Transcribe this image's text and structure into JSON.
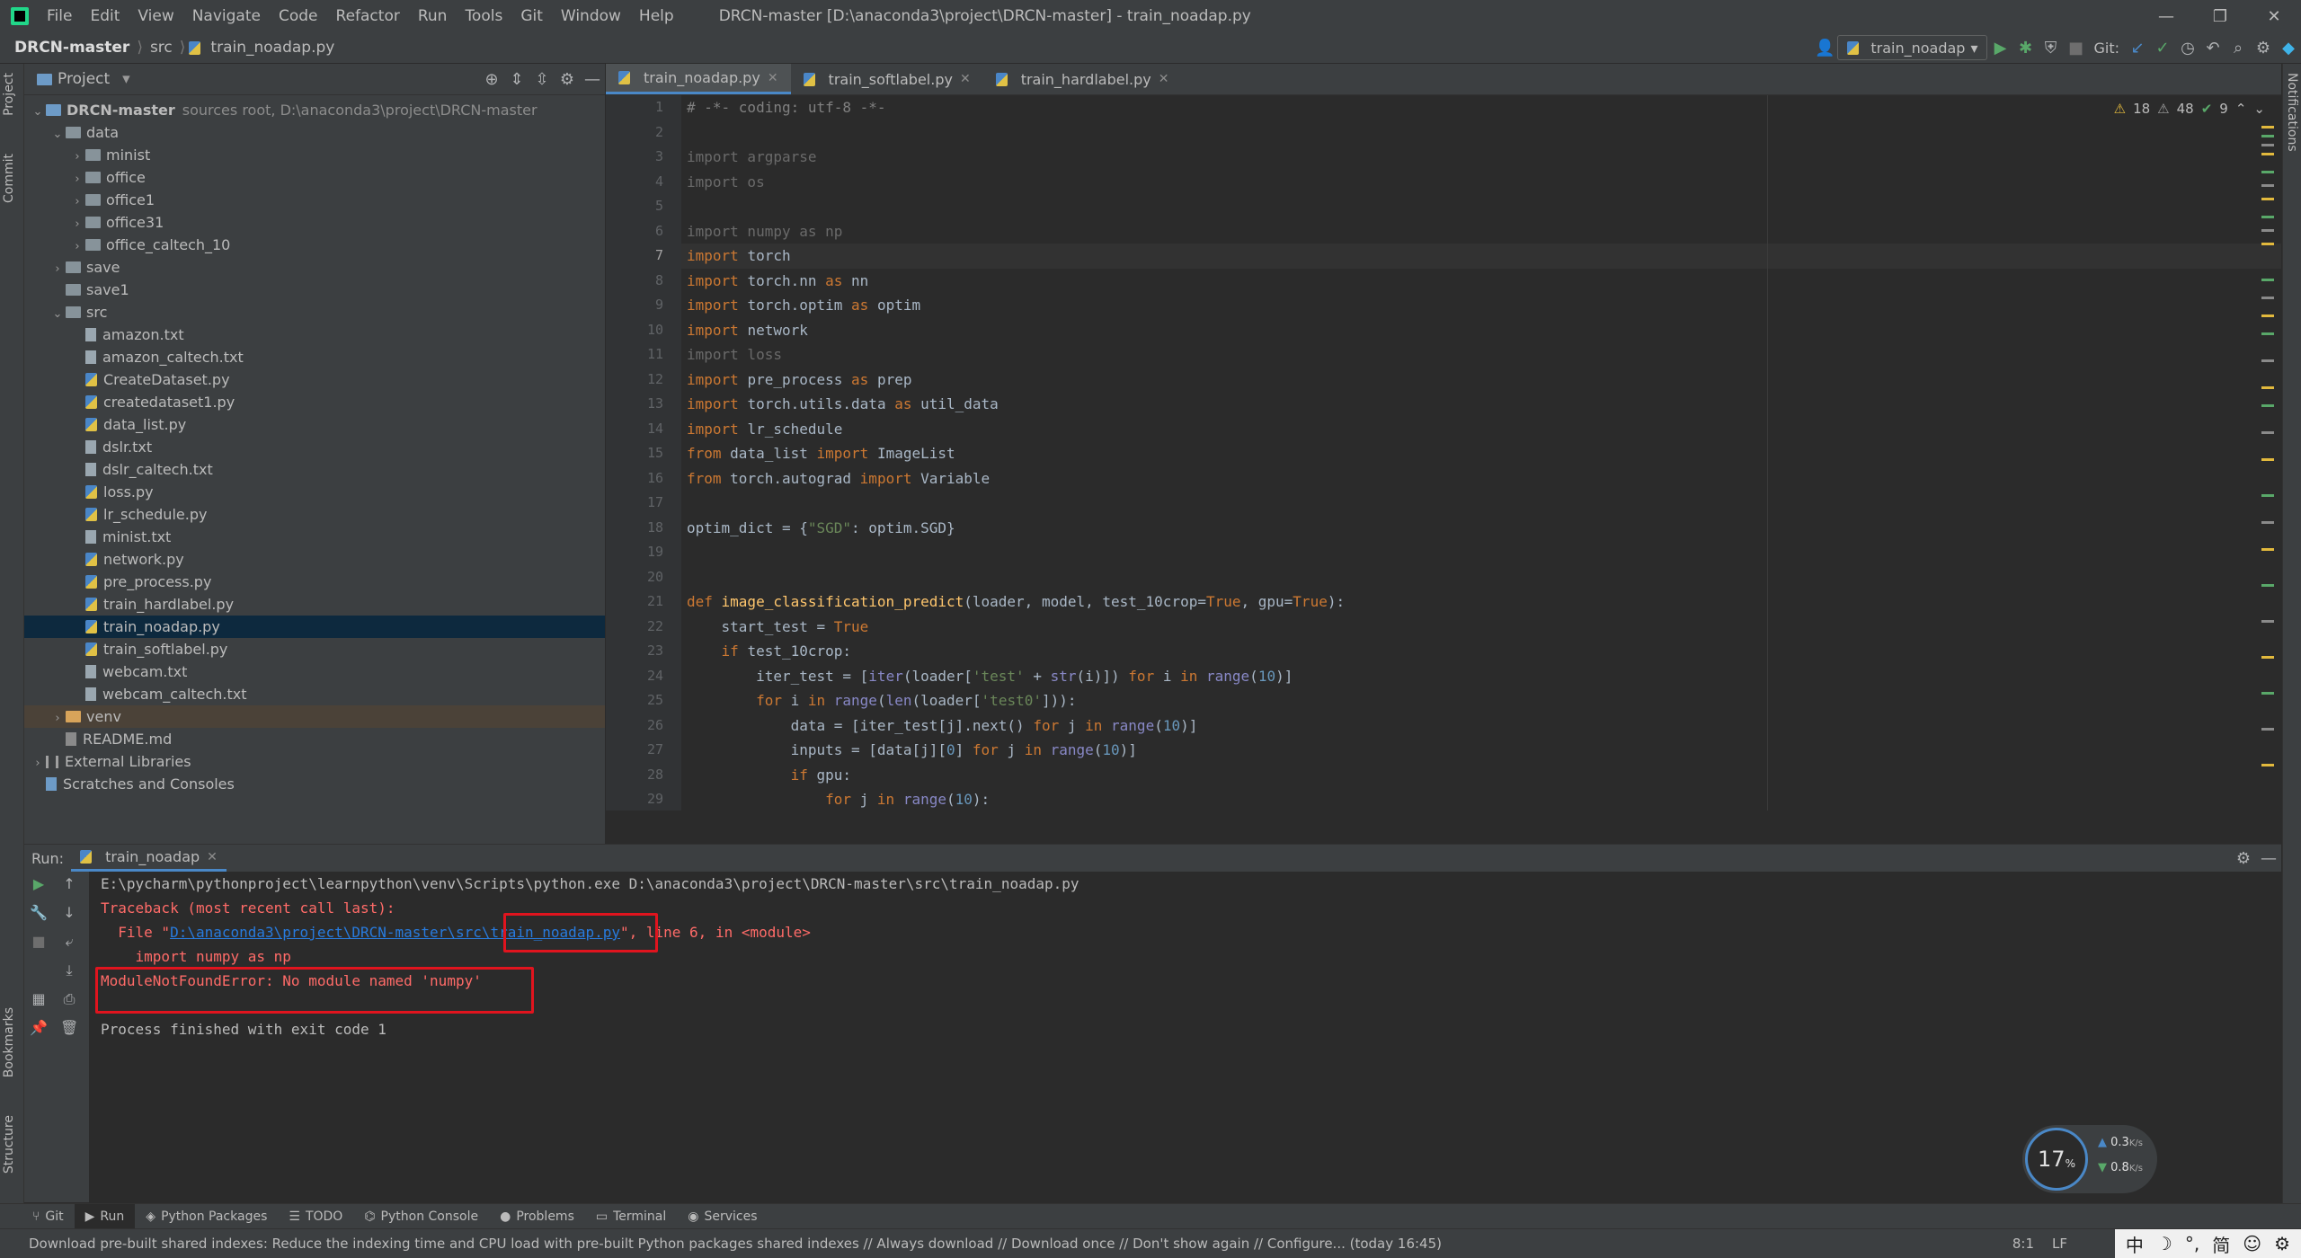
{
  "menu": [
    "File",
    "Edit",
    "View",
    "Navigate",
    "Code",
    "Refactor",
    "Run",
    "Tools",
    "Git",
    "Window",
    "Help"
  ],
  "window_title": "DRCN-master [D:\\anaconda3\\project\\DRCN-master] - train_noadap.py",
  "nav": {
    "project": "DRCN-master",
    "folder": "src",
    "file": "train_noadap.py"
  },
  "run_config": "train_noadap",
  "git_label": "Git:",
  "project_panel": {
    "title": "Project"
  },
  "tree": [
    {
      "label": "DRCN-master",
      "extra": "sources root,  D:\\anaconda3\\project\\DRCN-master",
      "depth": 0,
      "type": "folder-root",
      "open": true
    },
    {
      "label": "data",
      "depth": 1,
      "type": "folder",
      "open": true
    },
    {
      "label": "minist",
      "depth": 2,
      "type": "folder",
      "open": false
    },
    {
      "label": "office",
      "depth": 2,
      "type": "folder",
      "open": false
    },
    {
      "label": "office1",
      "depth": 2,
      "type": "folder",
      "open": false
    },
    {
      "label": "office31",
      "depth": 2,
      "type": "folder",
      "open": false
    },
    {
      "label": "office_caltech_10",
      "depth": 2,
      "type": "folder",
      "open": false
    },
    {
      "label": "save",
      "depth": 1,
      "type": "folder",
      "open": false
    },
    {
      "label": "save1",
      "depth": 1,
      "type": "folder",
      "open": null
    },
    {
      "label": "src",
      "depth": 1,
      "type": "folder",
      "open": true
    },
    {
      "label": "amazon.txt",
      "depth": 2,
      "type": "txt"
    },
    {
      "label": "amazon_caltech.txt",
      "depth": 2,
      "type": "txt"
    },
    {
      "label": "CreateDataset.py",
      "depth": 2,
      "type": "py"
    },
    {
      "label": "createdataset1.py",
      "depth": 2,
      "type": "py"
    },
    {
      "label": "data_list.py",
      "depth": 2,
      "type": "py"
    },
    {
      "label": "dslr.txt",
      "depth": 2,
      "type": "txt"
    },
    {
      "label": "dslr_caltech.txt",
      "depth": 2,
      "type": "txt"
    },
    {
      "label": "loss.py",
      "depth": 2,
      "type": "py"
    },
    {
      "label": "lr_schedule.py",
      "depth": 2,
      "type": "py"
    },
    {
      "label": "minist.txt",
      "depth": 2,
      "type": "txt"
    },
    {
      "label": "network.py",
      "depth": 2,
      "type": "py"
    },
    {
      "label": "pre_process.py",
      "depth": 2,
      "type": "py"
    },
    {
      "label": "train_hardlabel.py",
      "depth": 2,
      "type": "py"
    },
    {
      "label": "train_noadap.py",
      "depth": 2,
      "type": "py",
      "selected": true
    },
    {
      "label": "train_softlabel.py",
      "depth": 2,
      "type": "py"
    },
    {
      "label": "webcam.txt",
      "depth": 2,
      "type": "txt"
    },
    {
      "label": "webcam_caltech.txt",
      "depth": 2,
      "type": "txt"
    },
    {
      "label": "venv",
      "depth": 1,
      "type": "folder-orange",
      "open": false,
      "venv": true
    },
    {
      "label": "README.md",
      "depth": 1,
      "type": "md"
    },
    {
      "label": "External Libraries",
      "depth": 0,
      "type": "lib",
      "open": false
    },
    {
      "label": "Scratches and Consoles",
      "depth": 0,
      "type": "scratch"
    }
  ],
  "editor_tabs": [
    {
      "label": "train_noadap.py",
      "active": true
    },
    {
      "label": "train_softlabel.py",
      "active": false
    },
    {
      "label": "train_hardlabel.py",
      "active": false
    }
  ],
  "inspections": {
    "warnings": "18",
    "weak": "48",
    "ok": "9"
  },
  "code_lines": [
    [
      [
        "# -*- coding: utf-8 -*-",
        "#808080"
      ]
    ],
    [],
    [
      [
        "import argparse",
        "#6a6a6a"
      ]
    ],
    [
      [
        "import os",
        "#6a6a6a"
      ]
    ],
    [],
    [
      [
        "import numpy as np",
        "#6a6a6a"
      ]
    ],
    [
      [
        "import ",
        "#cc7832"
      ],
      [
        "torch",
        "#a9b7c6"
      ]
    ],
    [
      [
        "import ",
        "#cc7832"
      ],
      [
        "torch",
        "#a9b7c6"
      ],
      [
        ".nn ",
        "#a9b7c6"
      ],
      [
        "as ",
        "#cc7832"
      ],
      [
        "nn",
        "#a9b7c6"
      ]
    ],
    [
      [
        "import ",
        "#cc7832"
      ],
      [
        "torch",
        "#a9b7c6"
      ],
      [
        ".optim ",
        "#a9b7c6"
      ],
      [
        "as ",
        "#cc7832"
      ],
      [
        "optim",
        "#a9b7c6"
      ]
    ],
    [
      [
        "import ",
        "#cc7832"
      ],
      [
        "network",
        "#a9b7c6"
      ]
    ],
    [
      [
        "import loss",
        "#6a6a6a"
      ]
    ],
    [
      [
        "import ",
        "#cc7832"
      ],
      [
        "pre_process ",
        "#a9b7c6"
      ],
      [
        "as ",
        "#cc7832"
      ],
      [
        "prep",
        "#a9b7c6"
      ]
    ],
    [
      [
        "import ",
        "#cc7832"
      ],
      [
        "torch",
        "#a9b7c6"
      ],
      [
        ".utils.data ",
        "#a9b7c6"
      ],
      [
        "as ",
        "#cc7832"
      ],
      [
        "util_data",
        "#a9b7c6"
      ]
    ],
    [
      [
        "import ",
        "#cc7832"
      ],
      [
        "lr_schedule",
        "#a9b7c6"
      ]
    ],
    [
      [
        "from ",
        "#cc7832"
      ],
      [
        "data_list ",
        "#a9b7c6"
      ],
      [
        "import ",
        "#cc7832"
      ],
      [
        "ImageList",
        "#a9b7c6"
      ]
    ],
    [
      [
        "from ",
        "#cc7832"
      ],
      [
        "torch",
        "#a9b7c6"
      ],
      [
        ".autograd ",
        "#a9b7c6"
      ],
      [
        "import ",
        "#cc7832"
      ],
      [
        "Variable",
        "#a9b7c6"
      ]
    ],
    [],
    [
      [
        "optim_dict = {",
        "#a9b7c6"
      ],
      [
        "\"SGD\"",
        "#6a8759"
      ],
      [
        ": optim.SGD}",
        "#a9b7c6"
      ]
    ],
    [],
    [],
    [
      [
        "def ",
        "#cc7832"
      ],
      [
        "image_classification_predict",
        "#ffc66d"
      ],
      [
        "(loader, model, test_10crop=",
        "#a9b7c6"
      ],
      [
        "True",
        "#cc7832"
      ],
      [
        ", gpu=",
        "#a9b7c6"
      ],
      [
        "True",
        "#cc7832"
      ],
      [
        "):",
        "#a9b7c6"
      ]
    ],
    [
      [
        "    start_test = ",
        "#a9b7c6"
      ],
      [
        "True",
        "#cc7832"
      ]
    ],
    [
      [
        "    ",
        "#a9b7c6"
      ],
      [
        "if ",
        "#cc7832"
      ],
      [
        "test_10crop:",
        "#a9b7c6"
      ]
    ],
    [
      [
        "        iter_test = [",
        "#a9b7c6"
      ],
      [
        "iter",
        "#8888c6"
      ],
      [
        "(loader[",
        "#a9b7c6"
      ],
      [
        "'test'",
        "#6a8759"
      ],
      [
        " + ",
        "#a9b7c6"
      ],
      [
        "str",
        "#8888c6"
      ],
      [
        "(i)]) ",
        "#a9b7c6"
      ],
      [
        "for ",
        "#cc7832"
      ],
      [
        "i ",
        "#a9b7c6"
      ],
      [
        "in ",
        "#cc7832"
      ],
      [
        "range",
        "#8888c6"
      ],
      [
        "(",
        "#a9b7c6"
      ],
      [
        "10",
        "#6897bb"
      ],
      [
        ")]",
        "#a9b7c6"
      ]
    ],
    [
      [
        "        ",
        "#a9b7c6"
      ],
      [
        "for ",
        "#cc7832"
      ],
      [
        "i ",
        "#a9b7c6"
      ],
      [
        "in ",
        "#cc7832"
      ],
      [
        "range",
        "#8888c6"
      ],
      [
        "(",
        "#a9b7c6"
      ],
      [
        "len",
        "#8888c6"
      ],
      [
        "(loader[",
        "#a9b7c6"
      ],
      [
        "'test0'",
        "#6a8759"
      ],
      [
        "])):",
        "#a9b7c6"
      ]
    ],
    [
      [
        "            data = [",
        "#a9b7c6"
      ],
      [
        "iter_test[j].",
        "#a9b7c6"
      ],
      [
        "next",
        "#a9b7c6"
      ],
      [
        "() ",
        "#a9b7c6"
      ],
      [
        "for ",
        "#cc7832"
      ],
      [
        "j ",
        "#a9b7c6"
      ],
      [
        "in ",
        "#cc7832"
      ],
      [
        "range",
        "#8888c6"
      ],
      [
        "(",
        "#a9b7c6"
      ],
      [
        "10",
        "#6897bb"
      ],
      [
        ")]",
        "#a9b7c6"
      ]
    ],
    [
      [
        "            inputs = [data[j][",
        "#a9b7c6"
      ],
      [
        "0",
        "#6897bb"
      ],
      [
        "] ",
        "#a9b7c6"
      ],
      [
        "for ",
        "#cc7832"
      ],
      [
        "j ",
        "#a9b7c6"
      ],
      [
        "in ",
        "#cc7832"
      ],
      [
        "range",
        "#8888c6"
      ],
      [
        "(",
        "#a9b7c6"
      ],
      [
        "10",
        "#6897bb"
      ],
      [
        ")]",
        "#a9b7c6"
      ]
    ],
    [
      [
        "            ",
        "#a9b7c6"
      ],
      [
        "if ",
        "#cc7832"
      ],
      [
        "gpu:",
        "#a9b7c6"
      ]
    ],
    [
      [
        "                ",
        "#a9b7c6"
      ],
      [
        "for ",
        "#cc7832"
      ],
      [
        "j ",
        "#a9b7c6"
      ],
      [
        "in ",
        "#cc7832"
      ],
      [
        "range",
        "#8888c6"
      ],
      [
        "(",
        "#a9b7c6"
      ],
      [
        "10",
        "#6897bb"
      ],
      [
        "):",
        "#a9b7c6"
      ]
    ]
  ],
  "line_numbers": [
    "1",
    "2",
    "3",
    "4",
    "5",
    "6",
    "7",
    "8",
    "9",
    "10",
    "11",
    "12",
    "13",
    "14",
    "15",
    "16",
    "17",
    "18",
    "19",
    "20",
    "21",
    "22",
    "23",
    "24",
    "25",
    "26",
    "27",
    "28",
    "29"
  ],
  "run_panel": {
    "label": "Run:",
    "tab": "train_noadap"
  },
  "console": {
    "line1": "E:\\pycharm\\pythonproject\\learnpython\\venv\\Scripts\\python.exe D:\\anaconda3\\project\\DRCN-master\\src\\train_noadap.py",
    "line2": "Traceback (most recent call last):",
    "line3_pre": "  File \"",
    "line3_link1": "D:\\anaconda3\\project\\DRCN-master\\src\\",
    "line3_link2": "train_noadap.py",
    "line3_post": "\", line 6, in <module>",
    "line4": "    import numpy as np",
    "line5": "ModuleNotFoundError: No module named 'numpy'",
    "line6": "Process finished with exit code 1"
  },
  "network": {
    "cpu": "17",
    "cpu_unit": "%",
    "up": "0.3",
    "up_unit": "K/s",
    "down": "0.8",
    "down_unit": "K/s"
  },
  "bottom_tools": [
    {
      "label": "Git",
      "active": false
    },
    {
      "label": "Run",
      "active": true
    },
    {
      "label": "Python Packages",
      "active": false
    },
    {
      "label": "TODO",
      "active": false
    },
    {
      "label": "Python Console",
      "active": false
    },
    {
      "label": "Problems",
      "active": false
    },
    {
      "label": "Terminal",
      "active": false
    },
    {
      "label": "Services",
      "active": false
    }
  ],
  "status": {
    "message": "Download pre-built shared indexes: Reduce the indexing time and CPU load with pre-built Python packages shared indexes // Always download // Download once // Don't show again // Configure... (today 16:45)",
    "position": "8:1",
    "line_sep": "LF"
  },
  "ime": [
    "中",
    "☽",
    "°,",
    "简",
    "☺",
    "⚙"
  ],
  "side_tabs": {
    "project": "Project",
    "commit": "Commit",
    "bookmarks": "Bookmarks",
    "structure": "Structure",
    "notifications": "Notifications"
  }
}
